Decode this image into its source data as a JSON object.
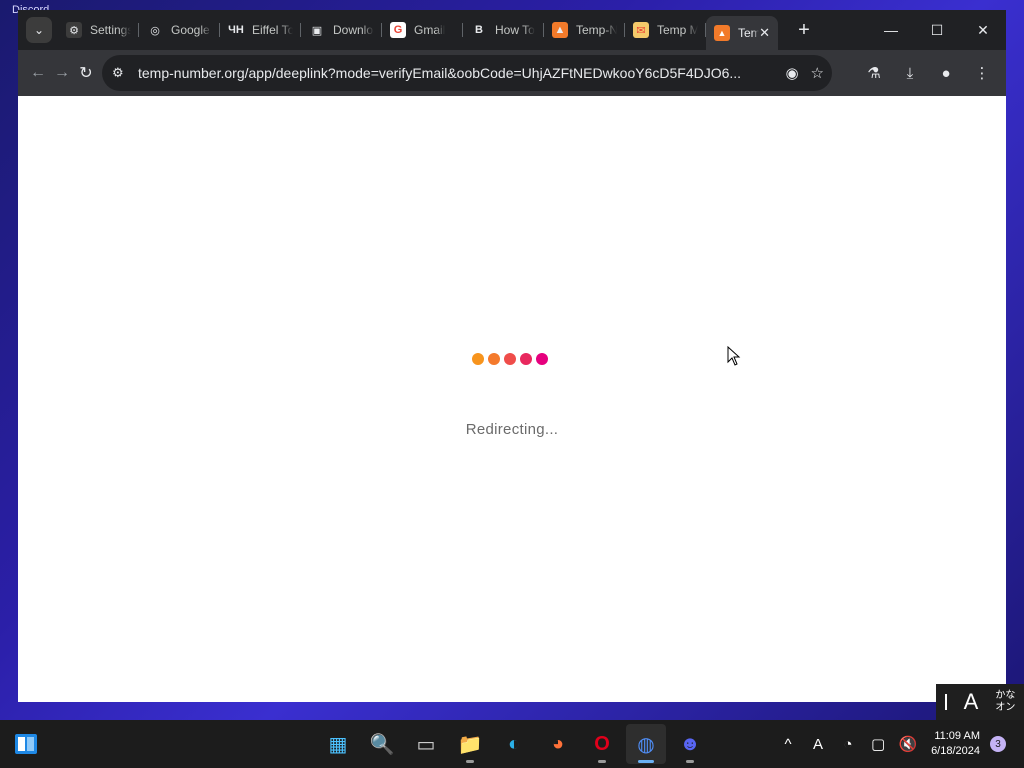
{
  "desktop": {
    "label": "Discord"
  },
  "browser": {
    "tabs": [
      {
        "label": "Settings",
        "icon": "gear-icon",
        "fav_color": "#3c3c3c",
        "glyph": "⚙"
      },
      {
        "label": "Google Lens",
        "icon": "google-lens-icon",
        "fav_color": "#202124",
        "glyph": "◎"
      },
      {
        "label": "Eiffel Tower",
        "icon": "site-logo-icon",
        "fav_color": "#202124",
        "glyph": "ЧН"
      },
      {
        "label": "Download",
        "icon": "download-site-icon",
        "fav_color": "#202124",
        "glyph": "▣"
      },
      {
        "label": "Gmail",
        "icon": "google-icon",
        "fav_color": "#ffffff",
        "glyph": "G"
      },
      {
        "label": "How To",
        "icon": "b-logo-icon",
        "fav_color": "#202124",
        "glyph": "B"
      },
      {
        "label": "Temp-Number",
        "icon": "temp-number-icon",
        "fav_color": "#f27a2a",
        "glyph": "▲"
      },
      {
        "label": "Temp Mail",
        "icon": "envelope-icon",
        "fav_color": "#f4c96a",
        "glyph": "✉"
      }
    ],
    "active_tab": {
      "label": "Temp-Number",
      "icon": "temp-number-icon",
      "close_glyph": "✕"
    },
    "new_tab_glyph": "+",
    "window_controls": {
      "minimize": "—",
      "maximize": "☐",
      "close": "✕"
    },
    "toolbar": {
      "back": "←",
      "forward": "→",
      "reload": "↻",
      "url": "temp-number.org/app/deeplink?mode=verifyEmail&oobCode=UhjAZFtNEDwkooY6cD5F4DJO6...",
      "site_info_glyph": "⚙",
      "eye_off_glyph": "◉",
      "star_glyph": "☆",
      "labs_glyph": "⚗",
      "download_glyph": "⤓",
      "profile_glyph": "●",
      "menu_glyph": "⋮"
    }
  },
  "page": {
    "status_text": "Redirecting...",
    "loader_colors": [
      "#f7941d",
      "#f47a2c",
      "#ef4d4a",
      "#e8285e",
      "#e6007e"
    ]
  },
  "ime": {
    "mode": "A",
    "kana_top": "かな",
    "kana_bottom": "オン"
  },
  "taskbar": {
    "apps": [
      {
        "name": "start-menu",
        "glyph": "▦",
        "color": "#4cc2ff",
        "running": false,
        "active": false
      },
      {
        "name": "search",
        "glyph": "🔍",
        "color": "#ffffff",
        "running": false,
        "active": false
      },
      {
        "name": "task-view",
        "glyph": "▭",
        "color": "#cccccc",
        "running": false,
        "active": false
      },
      {
        "name": "file-explorer",
        "glyph": "📁",
        "color": "#f8c43c",
        "running": true,
        "active": false
      },
      {
        "name": "edge",
        "glyph": "◐",
        "color": "#2ab0e8",
        "running": false,
        "active": false
      },
      {
        "name": "firefox",
        "glyph": "◕",
        "color": "#ff7139",
        "running": false,
        "active": false
      },
      {
        "name": "opera",
        "glyph": "O",
        "color": "#e0001b",
        "running": true,
        "active": false
      },
      {
        "name": "chrome",
        "glyph": "◍",
        "color": "#4f8df5",
        "running": true,
        "active": true
      },
      {
        "name": "discord",
        "glyph": "☻",
        "color": "#5865f2",
        "running": true,
        "active": false
      }
    ],
    "tray": {
      "chevron": "^",
      "font_a": "A",
      "ime_circle": "◔",
      "network": "▢",
      "volume": "🔇",
      "time": "11:09 AM",
      "date": "6/18/2024",
      "notifications": "3"
    }
  }
}
